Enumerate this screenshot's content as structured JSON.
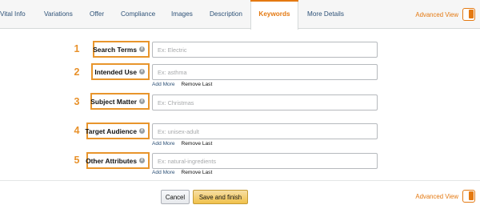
{
  "tabs": [
    {
      "label": "Vital Info"
    },
    {
      "label": "Variations"
    },
    {
      "label": "Offer"
    },
    {
      "label": "Compliance"
    },
    {
      "label": "Images"
    },
    {
      "label": "Description"
    },
    {
      "label": "Keywords",
      "active": true
    },
    {
      "label": "More Details"
    }
  ],
  "advanced_view": {
    "label": "Advanced View"
  },
  "fields": [
    {
      "number": "1",
      "label": "Search Terms",
      "placeholder": "Ex: Electric",
      "value": ""
    },
    {
      "number": "2",
      "label": "Intended Use",
      "placeholder": "Ex: asthma",
      "value": "",
      "add_more": "Add More",
      "remove_last": "Remove Last"
    },
    {
      "number": "3",
      "label": "Subject Matter",
      "placeholder": "Ex: Christmas",
      "value": ""
    },
    {
      "number": "4",
      "label": "Target Audience",
      "placeholder": "Ex: unisex-adult",
      "value": "",
      "add_more": "Add More",
      "remove_last": "Remove Last"
    },
    {
      "number": "5",
      "label": "Other Attributes",
      "placeholder": "Ex: natural-ingredients",
      "value": "",
      "add_more": "Add More",
      "remove_last": "Remove Last"
    }
  ],
  "footer": {
    "cancel_label": "Cancel",
    "save_label": "Save and finish"
  },
  "colors": {
    "accent": "#e47911",
    "label_border": "#e8952c",
    "link": "#2d5177",
    "save_button": "#f0c14b"
  },
  "icons": {
    "info": "info-icon",
    "toggle": "advanced-view-toggle"
  }
}
